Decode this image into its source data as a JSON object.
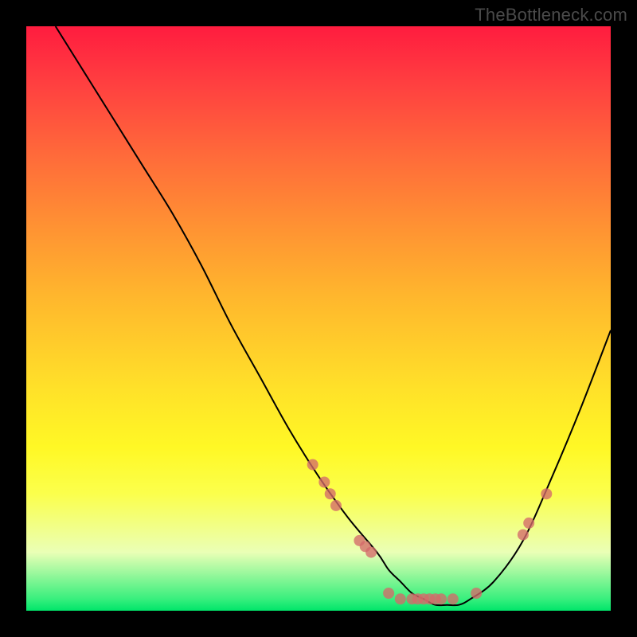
{
  "watermark": "TheBottleneck.com",
  "colors": {
    "page_bg": "#000000",
    "gradient_top": "#ff1c3f",
    "gradient_bottom": "#00e56a",
    "curve_stroke": "#000000",
    "dot_fill": "#d46a6a"
  },
  "chart_data": {
    "type": "line",
    "title": "",
    "xlabel": "",
    "ylabel": "",
    "xlim": [
      0,
      100
    ],
    "ylim": [
      0,
      100
    ],
    "grid": false,
    "series": [
      {
        "name": "curve",
        "x": [
          5,
          10,
          15,
          20,
          25,
          30,
          35,
          40,
          45,
          50,
          55,
          60,
          62,
          64,
          66,
          68,
          70,
          72,
          74,
          76,
          80,
          85,
          90,
          95,
          100
        ],
        "values": [
          100,
          92,
          84,
          76,
          68,
          59,
          49,
          40,
          31,
          23,
          16,
          10,
          7,
          5,
          3,
          2,
          1,
          1,
          1,
          2,
          5,
          12,
          23,
          35,
          48
        ]
      }
    ],
    "points": [
      {
        "name": "p1",
        "x": 49,
        "y": 25
      },
      {
        "name": "p2",
        "x": 51,
        "y": 22
      },
      {
        "name": "p3",
        "x": 52,
        "y": 20
      },
      {
        "name": "p4",
        "x": 53,
        "y": 18
      },
      {
        "name": "p5",
        "x": 57,
        "y": 12
      },
      {
        "name": "p6",
        "x": 58,
        "y": 11
      },
      {
        "name": "p7",
        "x": 59,
        "y": 10
      },
      {
        "name": "p8",
        "x": 62,
        "y": 3
      },
      {
        "name": "p9",
        "x": 64,
        "y": 2
      },
      {
        "name": "p10",
        "x": 66,
        "y": 2
      },
      {
        "name": "p11",
        "x": 67,
        "y": 2
      },
      {
        "name": "p12",
        "x": 68,
        "y": 2
      },
      {
        "name": "p13",
        "x": 69,
        "y": 2
      },
      {
        "name": "p14",
        "x": 70,
        "y": 2
      },
      {
        "name": "p15",
        "x": 71,
        "y": 2
      },
      {
        "name": "p16",
        "x": 73,
        "y": 2
      },
      {
        "name": "p17",
        "x": 77,
        "y": 3
      },
      {
        "name": "p18",
        "x": 85,
        "y": 13
      },
      {
        "name": "p19",
        "x": 86,
        "y": 15
      },
      {
        "name": "p20",
        "x": 89,
        "y": 20
      }
    ],
    "dot_radius_px": 7
  }
}
